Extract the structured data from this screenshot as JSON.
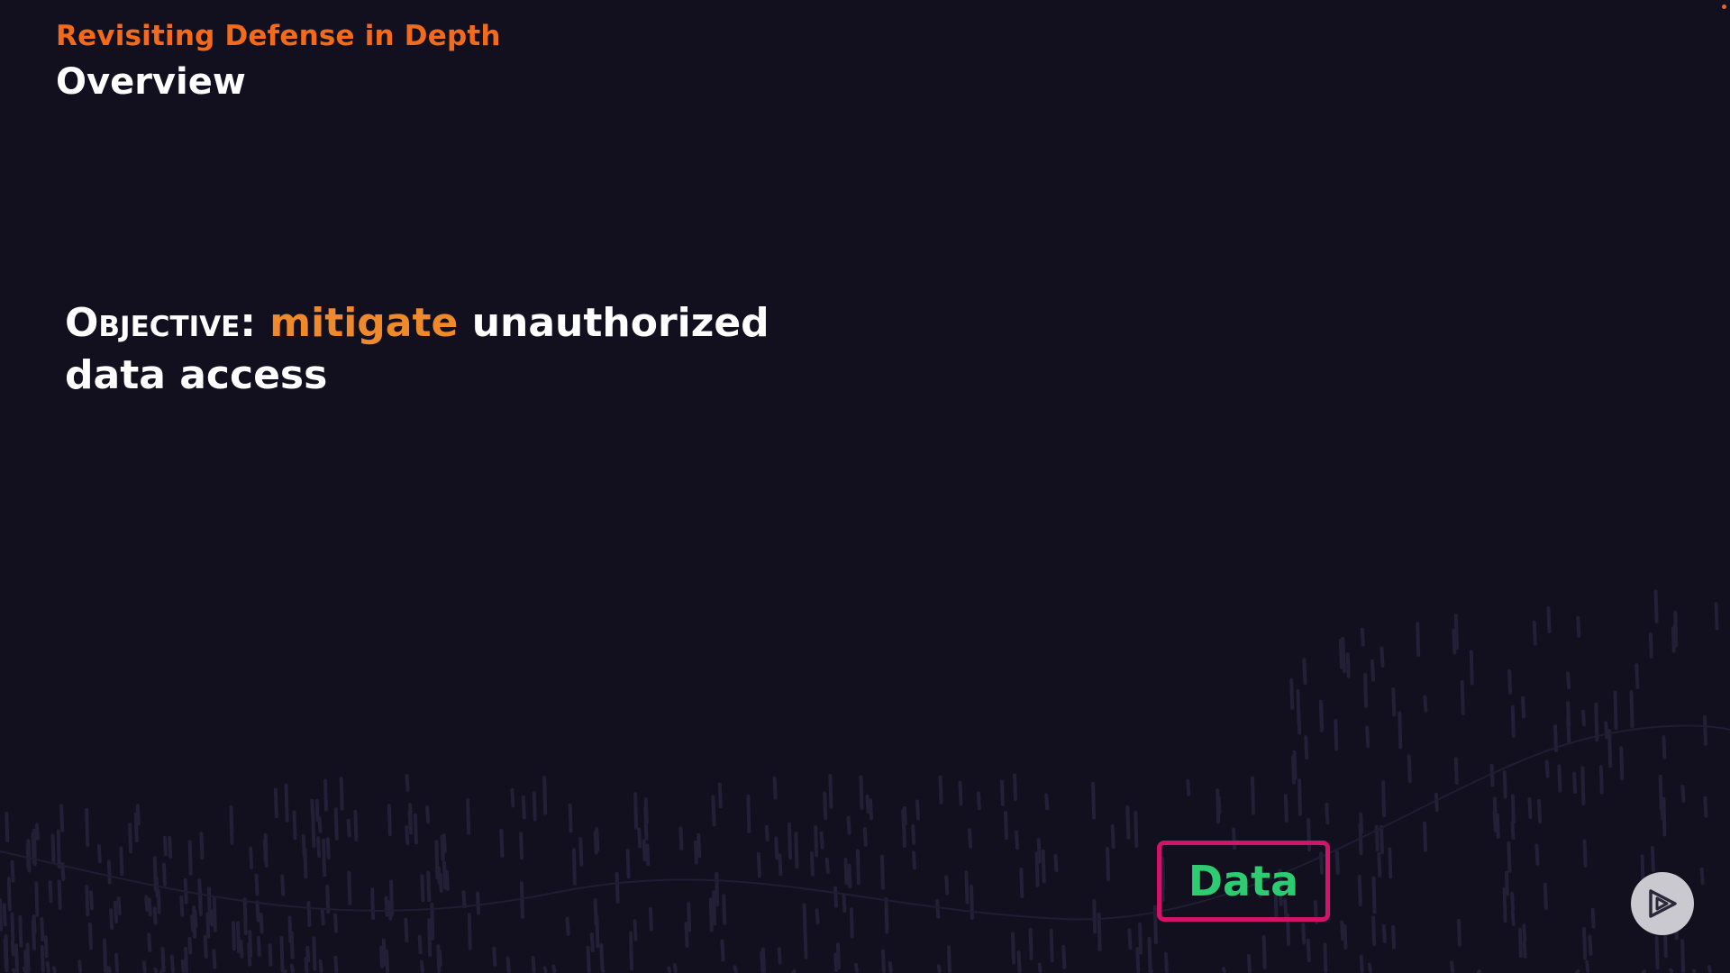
{
  "header": {
    "module_title": "Revisiting Defense in Depth",
    "section_title": "Overview"
  },
  "objective": {
    "label": "Objective:",
    "highlight": "mitigate",
    "text_rest": "unauthorized data access"
  },
  "data_box": {
    "label": "Data"
  },
  "icons": {
    "play": "play-logo-icon"
  },
  "colors": {
    "background": "#12101f",
    "module_title": "#f26b1d",
    "highlight": "#ee8a2a",
    "data_text": "#2ecc71",
    "data_border": "#d1136a",
    "white": "#ffffff"
  }
}
